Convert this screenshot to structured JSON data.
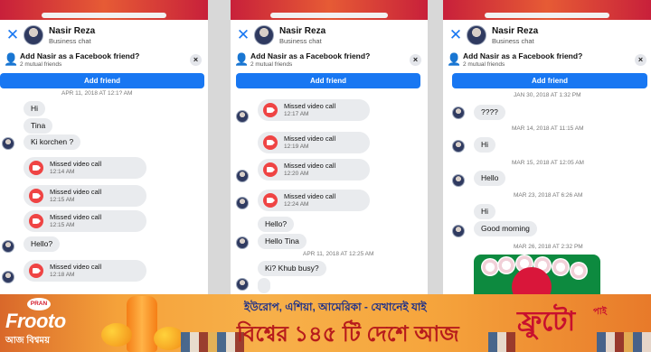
{
  "panels": [
    {
      "header": {
        "name": "Nasir Reza",
        "subtitle": "Business chat"
      },
      "add_friend": {
        "title": "Add Nasir as a Facebook friend?",
        "mutual": "2 mutual friends",
        "button": "Add friend",
        "dismiss": "×"
      },
      "timestamp": "APR 11, 2018 AT 12:1? AM",
      "messages": [
        "Hi",
        "Tina",
        "Ki korchen ?",
        "Hello?"
      ],
      "calls": [
        {
          "title": "Missed video call",
          "time": "12:14 AM"
        },
        {
          "title": "Missed video call",
          "time": "12:15 AM"
        },
        {
          "title": "Missed video call",
          "time": "12:15 AM"
        },
        {
          "title": "Missed video call",
          "time": "12:18 AM"
        }
      ]
    },
    {
      "header": {
        "name": "Nasir Reza",
        "subtitle": "Business chat"
      },
      "add_friend": {
        "title": "Add Nasir as a Facebook friend?",
        "mutual": "2 mutual friends",
        "button": "Add friend",
        "dismiss": "×"
      },
      "calls": [
        {
          "title": "Missed video call",
          "time": "12:17 AM"
        },
        {
          "title": "Missed video call",
          "time": "12:19 AM"
        },
        {
          "title": "Missed video call",
          "time": "12:20 AM"
        },
        {
          "title": "Missed video call",
          "time": "12:24 AM"
        }
      ],
      "messages": [
        "Hello?",
        "Hello Tina",
        "Ki? Khub busy?"
      ],
      "timestamps": [
        "APR 11, 2018 AT 12:25 AM"
      ]
    },
    {
      "header": {
        "name": "Nasir Reza",
        "subtitle": "Business chat"
      },
      "add_friend": {
        "title": "Add Nasir as a Facebook friend?",
        "mutual": "2 mutual friends",
        "button": "Add friend",
        "dismiss": "×"
      },
      "timestamps": [
        "JAN 30, 2018 AT 1:32 PM",
        "MAR 14, 2018 AT 11:15 AM",
        "MAR 15, 2018 AT 12:05 AM",
        "MAR 23, 2018 AT 6:26 AM",
        "MAR 26, 2018 AT 2:32 PM"
      ],
      "messages": [
        "????",
        "Hi",
        "Hello",
        "Hi",
        "Good morning"
      ]
    }
  ],
  "ad": {
    "logo": "PRAN",
    "brand": "Frooto",
    "tagline": "আজ বিশ্বময়",
    "headline_top": "ইউরোপ, এশিয়া, আমেরিকা - যেখানেই যাই",
    "headline_bottom": "বিশ্বের ১৪৫ টি দেশে আজ",
    "brand_right": "ফ্রুটো",
    "brand_right_small": "পাই"
  },
  "icons": {
    "close": "close-icon",
    "add_user": "add-user-icon",
    "video_camera": "video-camera-icon"
  },
  "colors": {
    "accent": "#1877f2",
    "missed_call": "#ef4444",
    "bubble": "#e9ebee"
  }
}
